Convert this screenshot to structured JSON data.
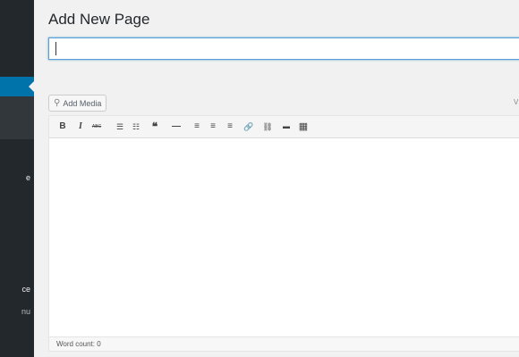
{
  "sidebar": {
    "items": [
      {
        "label": "e"
      },
      {
        "label": "ce"
      },
      {
        "label": "nu"
      }
    ]
  },
  "page": {
    "title": "Add New Page"
  },
  "title_input": {
    "value": ""
  },
  "media": {
    "label": "Add Media"
  },
  "toolbar": {
    "buttons": [
      {
        "name": "bold",
        "glyph": "B"
      },
      {
        "name": "italic",
        "glyph": "I"
      },
      {
        "name": "strikethrough",
        "glyph": "ABC"
      },
      {
        "name": "bulleted-list",
        "glyph": "☰"
      },
      {
        "name": "numbered-list",
        "glyph": "☷"
      },
      {
        "name": "blockquote",
        "glyph": "❝"
      },
      {
        "name": "horizontal-line",
        "glyph": "—"
      },
      {
        "name": "align-left",
        "glyph": "≡"
      },
      {
        "name": "align-center",
        "glyph": "≡"
      },
      {
        "name": "align-right",
        "glyph": "≡"
      },
      {
        "name": "insert-link",
        "glyph": "🔗"
      },
      {
        "name": "remove-link",
        "glyph": "⛓"
      },
      {
        "name": "read-more",
        "glyph": "▬"
      },
      {
        "name": "toolbar-toggle",
        "glyph": "▦"
      }
    ]
  },
  "editor": {
    "word_count": "Word count: 0"
  }
}
